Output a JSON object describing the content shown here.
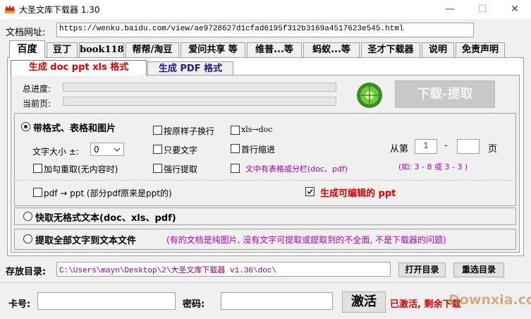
{
  "window": {
    "title": "大圣文库下载器 1.30",
    "minimize_glyph": "—",
    "maximize_glyph": "☐",
    "close_glyph": "✕"
  },
  "url_bar": {
    "label": "文档网址:",
    "value": "https://wenku.baidu.com/view/ae9728627d1cfad6195f312b3169a4517623e545.html"
  },
  "tabs": [
    {
      "label": "百度",
      "active": true
    },
    {
      "label": "豆丁"
    },
    {
      "label": "book118"
    },
    {
      "label": "帮帮/淘豆"
    },
    {
      "label": "爱问共享 等"
    },
    {
      "label": "维普...等"
    },
    {
      "label": "蚂蚁...等"
    },
    {
      "label": "圣才下载器"
    },
    {
      "label": "说明"
    },
    {
      "label": "免责声明"
    }
  ],
  "subtabs": [
    {
      "label": "生成 doc ppt xls 格式",
      "active": true
    },
    {
      "label": "生成 PDF 格式"
    }
  ],
  "progress": {
    "total_label": "总进度:",
    "total_value": 0,
    "page_label": "当前页:",
    "page_value": 0
  },
  "download_button": "下载-提取",
  "options": {
    "format_radio": "带格式、表格和图片",
    "keep_linebreak": "按原样子换行",
    "xls_to_doc": "xls→doc",
    "font_size_label": "文字大小 ±:",
    "font_size_value": "0",
    "text_only": "只要文字",
    "first_line_indent": "首行缩进",
    "recheck": "加勾重取(无内容时)",
    "force_extract": "强行提取",
    "table_or_columns": "文中有表格或分栏(doc、pdf)",
    "pdf_to_ppt": "pdf → ppt (部分pdf原来是ppt的)",
    "editable_ppt": "生成可编辑的 ppt",
    "editable_ppt_checked": true
  },
  "page_range": {
    "from_label": "从第",
    "from_value": "1",
    "dash": "-",
    "to_value": "",
    "page_label": "页",
    "hint": "(如: 3 - 8  或 3 - 3 )"
  },
  "radios": {
    "quick_text": "快取无格式文本(doc、xls、pdf)",
    "extract_all": "提取全部文字到文本文件",
    "extract_note": "(有的文档是纯图片, 没有文字可提取或提取到的不全面, 不是下载器的问题)"
  },
  "save_dir": {
    "label": "存放目录:",
    "value": "C:\\Users\\mayn\\Desktop\\2\\大圣文库下载器 v1.30\\doc\\",
    "open_button": "打开目录",
    "choose_button": "重选目录"
  },
  "activation": {
    "card_label": "卡号:",
    "card_value": "",
    "password_label": "密码:",
    "password_value": "",
    "activate_button": "激活",
    "status": "已激活, 剩余下载",
    "watermark": "Downxia.com"
  },
  "colors": {
    "red": "#e00000",
    "purple": "#b000b0",
    "button_disabled_bg": "#c8c8c8"
  }
}
